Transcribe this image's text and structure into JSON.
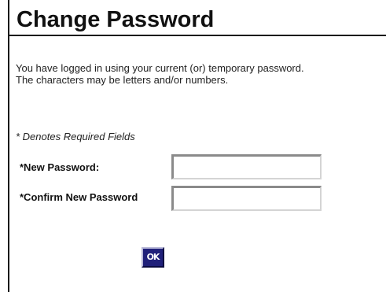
{
  "header": {
    "title": "Change Password"
  },
  "instructions": {
    "line1": "You have logged in using your current (or) temporary password.",
    "line2": "The characters may be letters and/or numbers."
  },
  "required_note": "* Denotes Required Fields",
  "form": {
    "new_password": {
      "label": "*New Password:",
      "value": ""
    },
    "confirm_password": {
      "label": "*Confirm New Password",
      "value": ""
    },
    "submit_label": "OK"
  },
  "colors": {
    "button_background": "#20207a",
    "text": "#111111"
  }
}
